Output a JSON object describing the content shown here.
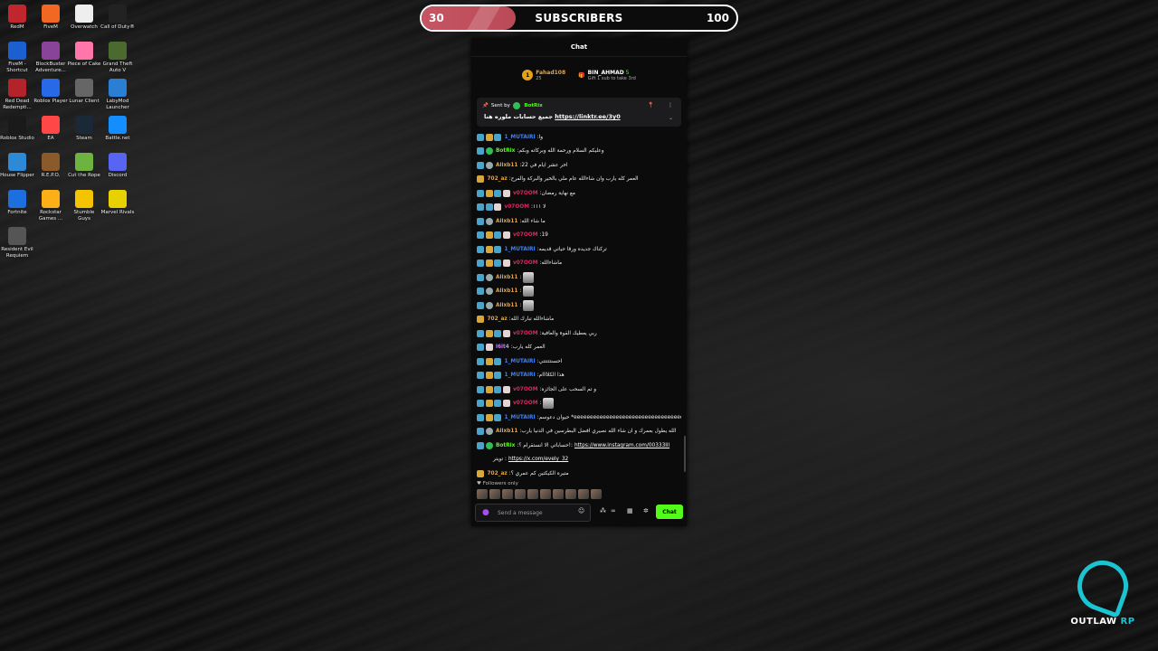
{
  "desktop": {
    "icons": [
      {
        "label": "RedM",
        "color": "#c0262e"
      },
      {
        "label": "FiveM",
        "color": "#f26722"
      },
      {
        "label": "Overwatch",
        "color": "#eeeeee"
      },
      {
        "label": "Call of Duty®",
        "color": "#222222"
      },
      {
        "label": "FiveM - Shortcut",
        "color": "#1c5fd1"
      },
      {
        "label": "BlockBuster Adventure...",
        "color": "#884499"
      },
      {
        "label": "Piece of Cake",
        "color": "#ff77aa"
      },
      {
        "label": "Grand Theft Auto V",
        "color": "#4a6b2d"
      },
      {
        "label": "Red Dead Redempti...",
        "color": "#b3242a"
      },
      {
        "label": "Roblox Player",
        "color": "#2869e8"
      },
      {
        "label": "Lunar Client",
        "color": "#666666"
      },
      {
        "label": "LabyMod Launcher",
        "color": "#2a7fd2"
      },
      {
        "label": "Roblox Studio",
        "color": "#1a1a1a"
      },
      {
        "label": "EA",
        "color": "#ff4747"
      },
      {
        "label": "Steam",
        "color": "#1b2838"
      },
      {
        "label": "Battle.net",
        "color": "#148eff"
      },
      {
        "label": "House Flipper",
        "color": "#2d8ad6"
      },
      {
        "label": "R.E.P.O.",
        "color": "#8b5a2b"
      },
      {
        "label": "Cut the Rope",
        "color": "#6cb33f"
      },
      {
        "label": "Discord",
        "color": "#5865f2"
      },
      {
        "label": "Fortnite",
        "color": "#1d6fe0"
      },
      {
        "label": "Rockstar Games ...",
        "color": "#fcaf17"
      },
      {
        "label": "Stumble Guys",
        "color": "#f5c400"
      },
      {
        "label": "Marvel Rivals",
        "color": "#e8d100"
      },
      {
        "label": "Resident Evil Requiem",
        "color": "#555555"
      }
    ]
  },
  "subscribers": {
    "title": "SUBSCRIBERS",
    "current": "30",
    "goal": "100",
    "progress": 0.3
  },
  "chat": {
    "header": "Chat",
    "leaderboard": [
      {
        "rank": "1",
        "name": "Fahad108",
        "count": "25"
      },
      {
        "name": "BIN_AHMAD",
        "count": "5",
        "subtitle": "Gift 1 sub to take 3rd"
      }
    ],
    "pinned": {
      "sent_by": "Sent by",
      "author": "BotRix",
      "text": "جميع حسابات ملوره هنا",
      "link": "https://linktr.ee/3y0"
    },
    "messages": [
      {
        "badges": [
          "sub",
          "crown",
          "sub"
        ],
        "user": "1_MUTAIRI",
        "color": "#3b82f6",
        "text": "وا"
      },
      {
        "badges": [
          "sub",
          "bot"
        ],
        "user": "BotRix",
        "color": "#53fc18",
        "text": "وعليكم السلام ورحمة الله وبركاته وبكم"
      },
      {
        "badges": [
          "sub",
          "mod"
        ],
        "user": "Alixb11",
        "color": "#e8a23a",
        "text": "اخر عشر ايام في 22"
      },
      {
        "badges": [
          "crown"
        ],
        "user": "702_az",
        "color": "#e8a23a",
        "text": "العمر كله يارب وان شاءالله عام ملي بالخير والبركة والفرح"
      },
      {
        "badges": [
          "sub",
          "crown",
          "sub",
          "gift"
        ],
        "user": "v07OOM",
        "color": "#e0245e",
        "text": "مع نهاية رمضان"
      },
      {
        "badges": [
          "sub",
          "sub",
          "gift"
        ],
        "user": "v07OOM",
        "color": "#e0245e",
        "text": "لا ١١١"
      },
      {
        "badges": [
          "sub",
          "mod"
        ],
        "user": "Alixb11",
        "color": "#e8a23a",
        "text": "ما شاء الله"
      },
      {
        "badges": [
          "sub",
          "crown",
          "sub",
          "gift"
        ],
        "user": "v07OOM",
        "color": "#e0245e",
        "text": "19"
      },
      {
        "badges": [
          "sub",
          "crown",
          "sub"
        ],
        "user": "1_MUTAIRI",
        "color": "#3b82f6",
        "text": "تركناك جديده ورقا حياتي قديمه"
      },
      {
        "badges": [
          "sub",
          "crown",
          "sub",
          "gift"
        ],
        "user": "v07OOM",
        "color": "#e0245e",
        "text": "ماشاءالله"
      },
      {
        "badges": [
          "sub",
          "mod"
        ],
        "user": "Alixb11",
        "color": "#e8a23a",
        "text": "",
        "emote": true
      },
      {
        "badges": [
          "sub",
          "mod"
        ],
        "user": "Alixb11",
        "color": "#e8a23a",
        "text": "",
        "emote": true
      },
      {
        "badges": [
          "sub",
          "mod"
        ],
        "user": "Alixb11",
        "color": "#e8a23a",
        "text": "",
        "emote": true
      },
      {
        "badges": [
          "crown"
        ],
        "user": "702_az",
        "color": "#e8a23a",
        "text": "ماشاءالله تبارك الله"
      },
      {
        "badges": [
          "sub",
          "crown",
          "sub",
          "gift"
        ],
        "user": "v07OOM",
        "color": "#e0245e",
        "text": "ربي يعطيك القوة والعافية"
      },
      {
        "badges": [
          "sub",
          "gift"
        ],
        "user": "l6it4",
        "color": "#c77dff",
        "text": "العمر كله يارب"
      },
      {
        "badges": [
          "sub",
          "crown",
          "sub"
        ],
        "user": "1_MUTAIRI",
        "color": "#3b82f6",
        "text": "احسنتتتتتي"
      },
      {
        "badges": [
          "sub",
          "crown",
          "sub"
        ],
        "user": "1_MUTAIRI",
        "color": "#3b82f6",
        "text": "هذا الكلاااام"
      },
      {
        "badges": [
          "sub",
          "crown",
          "sub",
          "gift"
        ],
        "user": "v07OOM",
        "color": "#e0245e",
        "text": "و تم السحب على الجائزه"
      },
      {
        "badges": [
          "sub",
          "crown",
          "sub",
          "gift"
        ],
        "user": "v07OOM",
        "color": "#e0245e",
        "text": "",
        "emote": true
      },
      {
        "badges": [
          "sub",
          "crown",
          "sub"
        ],
        "user": "1_MUTAIRI",
        "color": "#3b82f6",
        "text": "حيوان دعوسم *eeeeeeeeeeeeeeeeeeeeeeeeeeeeeeeeeeee*"
      },
      {
        "badges": [
          "sub",
          "mod"
        ],
        "user": "Alixb11",
        "color": "#e8a23a",
        "text": "الله يطول بعمرك و ان شاء الله نصيري افضل البطرسين في الدنيا يارب"
      },
      {
        "badges": [
          "sub",
          "bot"
        ],
        "user": "BotRix",
        "color": "#53fc18",
        "text": "حساباتي الا انستقرام ؟!:",
        "link": "https://www.instagram.com/00333lll"
      },
      {
        "badges": [],
        "user": "",
        "color": "#ffffff",
        "text": "",
        "link": "https://x.com/evely_32",
        "prefix": "تويتر :"
      },
      {
        "badges": [
          "crown"
        ],
        "user": "702_az",
        "color": "#e8a23a",
        "text": "متيره الكيكتين كم عمري ؟"
      }
    ],
    "followers_only": "Followers only",
    "input_placeholder": "Send a message",
    "send_label": "Chat"
  },
  "branding": {
    "logo_main": "OUTLAW",
    "logo_accent": "RP"
  }
}
